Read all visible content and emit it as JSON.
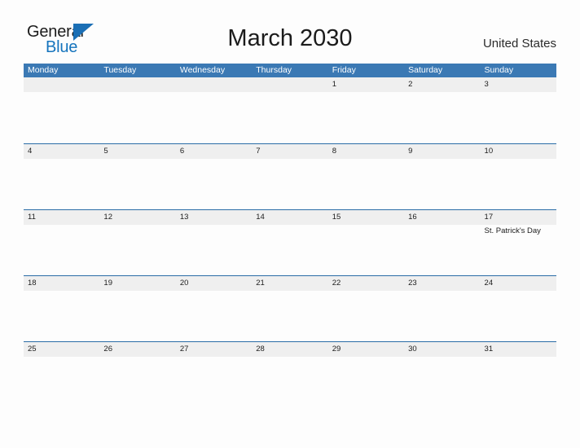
{
  "brand": {
    "word_one": "General",
    "word_two": "Blue",
    "triangle_icon": "triangle-icon",
    "accent_color": "#1574bd"
  },
  "header": {
    "title": "March 2030",
    "country": "United States"
  },
  "theme": {
    "header_blue": "#3b79b4",
    "rule_blue": "#2a6ca6",
    "band_gray": "#efefef",
    "page_background": "#fdfdfd",
    "text_color": "#1c1c1c"
  },
  "calendar": {
    "weekdays": [
      "Monday",
      "Tuesday",
      "Wednesday",
      "Thursday",
      "Friday",
      "Saturday",
      "Sunday"
    ],
    "weeks": [
      {
        "days": [
          {
            "num": "",
            "event": ""
          },
          {
            "num": "",
            "event": ""
          },
          {
            "num": "",
            "event": ""
          },
          {
            "num": "",
            "event": ""
          },
          {
            "num": "1",
            "event": ""
          },
          {
            "num": "2",
            "event": ""
          },
          {
            "num": "3",
            "event": ""
          }
        ]
      },
      {
        "days": [
          {
            "num": "4",
            "event": ""
          },
          {
            "num": "5",
            "event": ""
          },
          {
            "num": "6",
            "event": ""
          },
          {
            "num": "7",
            "event": ""
          },
          {
            "num": "8",
            "event": ""
          },
          {
            "num": "9",
            "event": ""
          },
          {
            "num": "10",
            "event": ""
          }
        ]
      },
      {
        "days": [
          {
            "num": "11",
            "event": ""
          },
          {
            "num": "12",
            "event": ""
          },
          {
            "num": "13",
            "event": ""
          },
          {
            "num": "14",
            "event": ""
          },
          {
            "num": "15",
            "event": ""
          },
          {
            "num": "16",
            "event": ""
          },
          {
            "num": "17",
            "event": "St. Patrick's Day"
          }
        ]
      },
      {
        "days": [
          {
            "num": "18",
            "event": ""
          },
          {
            "num": "19",
            "event": ""
          },
          {
            "num": "20",
            "event": ""
          },
          {
            "num": "21",
            "event": ""
          },
          {
            "num": "22",
            "event": ""
          },
          {
            "num": "23",
            "event": ""
          },
          {
            "num": "24",
            "event": ""
          }
        ]
      },
      {
        "days": [
          {
            "num": "25",
            "event": ""
          },
          {
            "num": "26",
            "event": ""
          },
          {
            "num": "27",
            "event": ""
          },
          {
            "num": "28",
            "event": ""
          },
          {
            "num": "29",
            "event": ""
          },
          {
            "num": "30",
            "event": ""
          },
          {
            "num": "31",
            "event": ""
          }
        ]
      }
    ]
  }
}
